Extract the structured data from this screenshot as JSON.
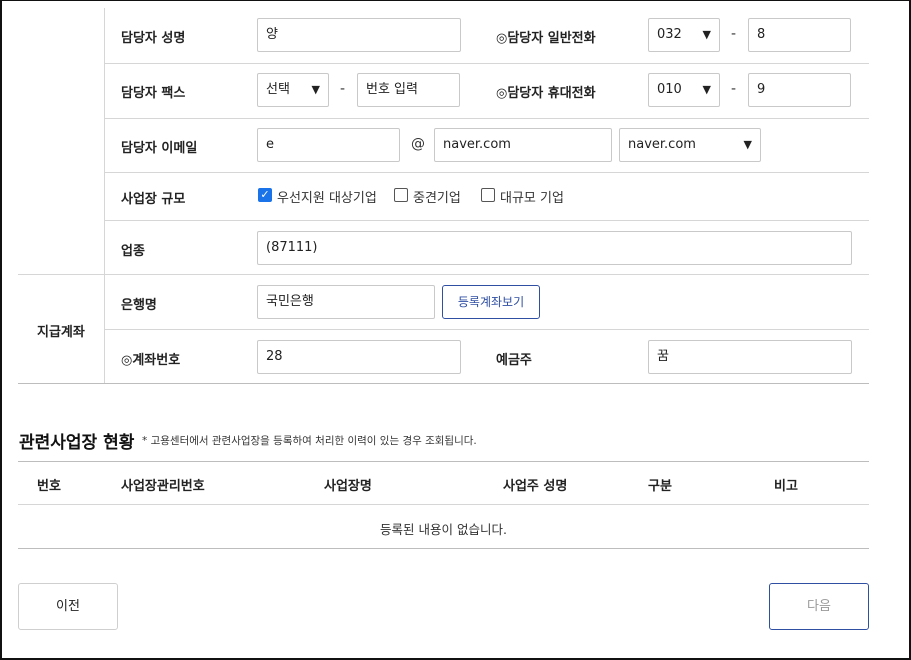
{
  "form": {
    "contact_name": {
      "label": "담당자 성명",
      "value": "양"
    },
    "contact_phone": {
      "label": "◎담당자 일반전화",
      "area": "032",
      "number": "8"
    },
    "contact_fax": {
      "label": "담당자 팩스",
      "select": "선택",
      "placeholder": "번호 입력"
    },
    "contact_mobile": {
      "label": "◎담당자 휴대전화",
      "prefix": "010",
      "number": "9"
    },
    "contact_email": {
      "label": "담당자 이메일",
      "local": "e",
      "at": "@",
      "domain": "naver.com",
      "domain_select": "naver.com"
    },
    "business_size": {
      "label": "사업장 규모",
      "options": [
        {
          "label": "우선지원 대상기업",
          "checked": true
        },
        {
          "label": "중견기업",
          "checked": false
        },
        {
          "label": "대규모 기업",
          "checked": false
        }
      ]
    },
    "industry": {
      "label": "업종",
      "value": "(87111)"
    },
    "payment": {
      "section_label": "지급계좌",
      "bank": {
        "label": "은행명",
        "value": "국민은행",
        "button": "등록계좌보기"
      },
      "account": {
        "label": "◎계좌번호",
        "value": "28"
      },
      "holder": {
        "label": "예금주",
        "value": "꿈"
      }
    },
    "dash": "-"
  },
  "related": {
    "title": "관련사업장 현황",
    "note": "* 고용센터에서 관련사업장을 등록하여 처리한 이력이 있는 경우 조회됩니다.",
    "columns": [
      "번호",
      "사업장관리번호",
      "사업장명",
      "사업주 성명",
      "구분",
      "비고"
    ],
    "empty_message": "등록된 내용이 없습니다."
  },
  "nav": {
    "prev": "이전",
    "next": "다음"
  },
  "colors": {
    "accent": "#2f4fa3",
    "checkbox": "#1a73e8",
    "border": "#d6d6d6"
  }
}
